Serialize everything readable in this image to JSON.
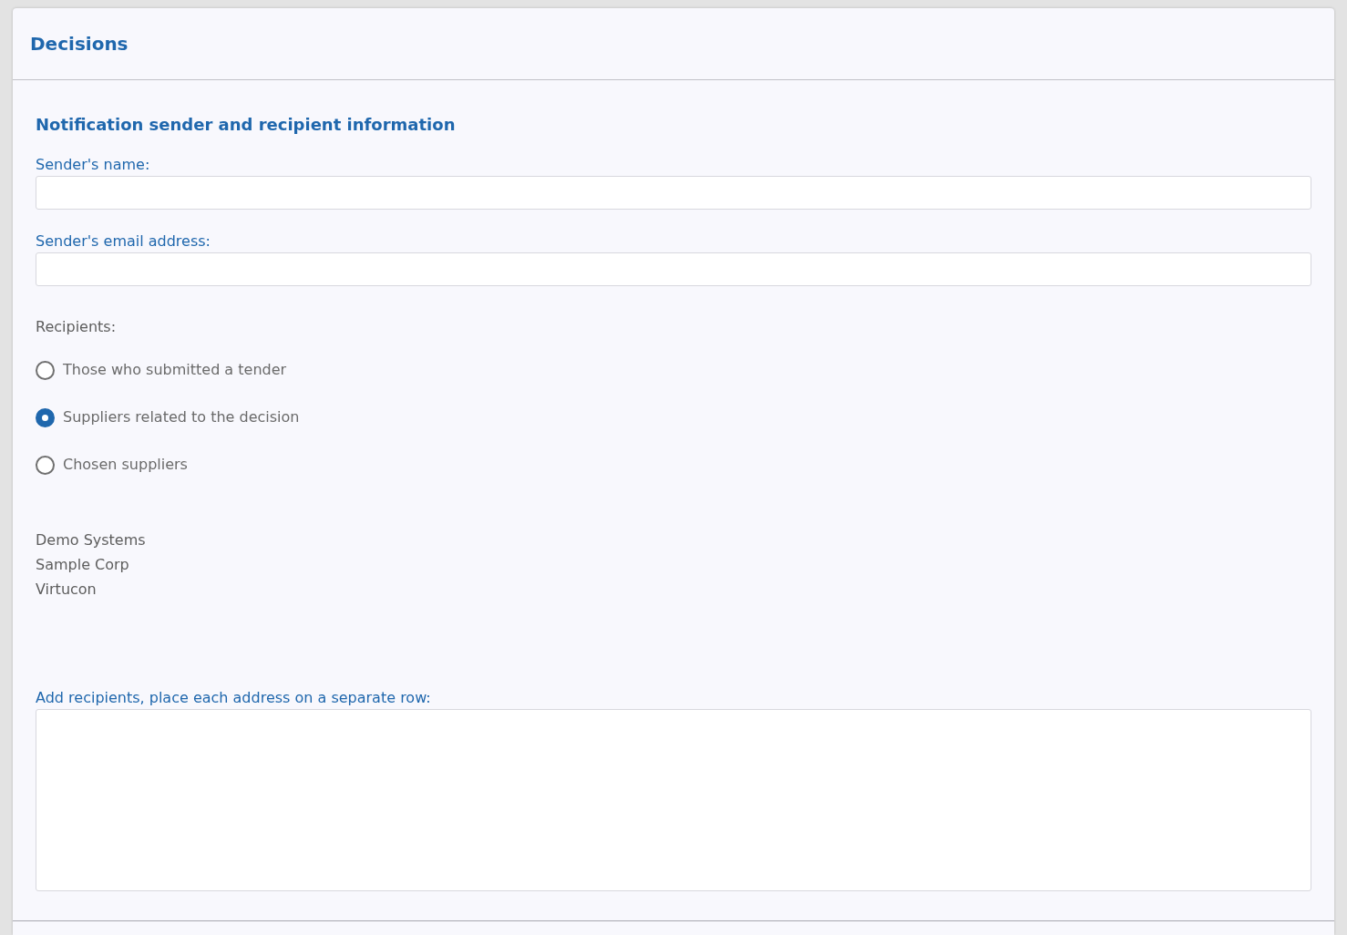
{
  "panel": {
    "title": "Decisions"
  },
  "section": {
    "heading": "Notification sender and recipient information"
  },
  "fields": [
    {
      "label": "Sender's name:"
    },
    {
      "label": "Sender's email address:"
    }
  ],
  "recipients": {
    "label": "Recipients:",
    "options": [
      {
        "label": "Those who submitted a tender",
        "selected": false
      },
      {
        "label": "Suppliers related to the decision",
        "selected": true
      },
      {
        "label": "Chosen suppliers",
        "selected": false
      }
    ],
    "suppliers": [
      "Demo Systems",
      "Sample Corp",
      "Virtucon"
    ]
  },
  "extra_recipients": {
    "label": "Add recipients, place each address on a separate row:"
  }
}
